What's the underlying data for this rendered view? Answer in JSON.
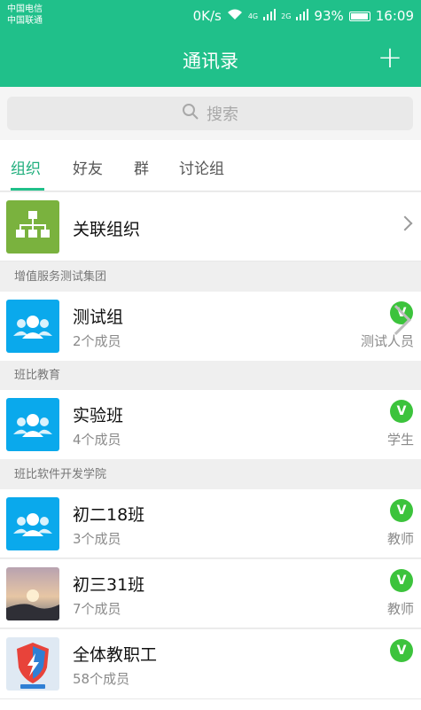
{
  "status": {
    "carrier1": "中国电信",
    "carrier2": "中国联通",
    "speed": "0K/s",
    "net1": "4G",
    "net2": "2G",
    "battery": "93%",
    "time": "16:09"
  },
  "appbar": {
    "title": "通讯录",
    "add_label": "+"
  },
  "search": {
    "placeholder": "搜索"
  },
  "tabs": [
    {
      "label": "组织"
    },
    {
      "label": "好友"
    },
    {
      "label": "群"
    },
    {
      "label": "讨论组"
    }
  ],
  "linked_org": {
    "label": "关联组织"
  },
  "sections": [
    {
      "title": "增值服务测试集团",
      "groups": [
        {
          "name": "测试组",
          "count": "2个成员",
          "badge": "V",
          "role": "测试人员"
        }
      ]
    },
    {
      "title": "班比教育",
      "groups": [
        {
          "name": "实验班",
          "count": "4个成员",
          "badge": "V",
          "role": "学生"
        }
      ]
    },
    {
      "title": "班比软件开发学院",
      "groups": [
        {
          "name": "初二18班",
          "count": "3个成员",
          "badge": "V",
          "role": "教师"
        },
        {
          "name": "初三31班",
          "count": "7个成员",
          "badge": "V",
          "role": "教师"
        },
        {
          "name": "全体教职工",
          "count": "58个成员",
          "badge": "V",
          "role": ""
        }
      ]
    }
  ],
  "colors": {
    "brand": "#20c08a",
    "badge": "#3cc33c",
    "group_icon": "#0aa9ec",
    "org_icon": "#7ab23e"
  },
  "icons": {
    "add": "plus-icon",
    "search": "search-icon",
    "org": "org-chart-icon",
    "group": "group-people-icon",
    "chevron": "chevron-right-icon"
  }
}
